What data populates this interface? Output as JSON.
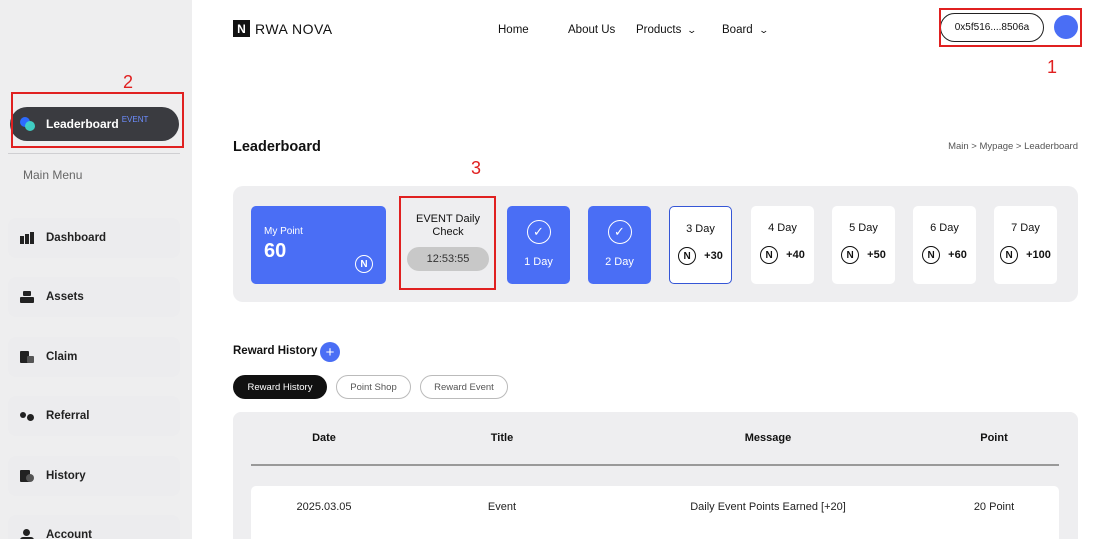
{
  "header": {
    "logo_mark": "N",
    "logo_text": "RWA NOVA",
    "nav": [
      {
        "label": "Home"
      },
      {
        "label": "About Us"
      },
      {
        "label": "Products",
        "icon": "chevron-down-icon"
      },
      {
        "label": "Board",
        "icon": "chevron-down-icon"
      }
    ],
    "wallet_address": "0x5f516....8506a",
    "avatar_color": "#4a6ef5"
  },
  "sidebar": {
    "active_item": {
      "label": "Leaderboard",
      "badge": "EVENT"
    },
    "section_label": "Main Menu",
    "items": [
      {
        "label": "Dashboard",
        "icon": "dashboard-icon"
      },
      {
        "label": "Assets",
        "icon": "assets-icon"
      },
      {
        "label": "Claim",
        "icon": "claim-icon"
      },
      {
        "label": "Referral",
        "icon": "referral-icon"
      },
      {
        "label": "History",
        "icon": "history-icon"
      },
      {
        "label": "Account",
        "icon": "account-icon"
      }
    ]
  },
  "page": {
    "title": "Leaderboard",
    "breadcrumb": "Main > Mypage > Leaderboard"
  },
  "checkin": {
    "my_point_label": "My Point",
    "my_point_value": "60",
    "coin_symbol": "N",
    "event_title": "EVENT Daily Check",
    "timer": "12:53:55",
    "completed_days": [
      {
        "label": "1 Day",
        "icon": "check-icon"
      },
      {
        "label": "2 Day",
        "icon": "check-icon"
      }
    ],
    "upcoming_days": [
      {
        "label": "3 Day",
        "reward": "+30",
        "current": true
      },
      {
        "label": "4 Day",
        "reward": "+40"
      },
      {
        "label": "5 Day",
        "reward": "+50"
      },
      {
        "label": "6 Day",
        "reward": "+60"
      },
      {
        "label": "7 Day",
        "reward": "+100"
      }
    ],
    "accent_color": "#4a6ef5"
  },
  "annotations": {
    "one": "1",
    "two": "2",
    "three": "3",
    "color": "#e02020"
  },
  "reward_history": {
    "title": "Reward History",
    "add_symbol": "+",
    "tabs": [
      {
        "label": "Reward History",
        "active": true
      },
      {
        "label": "Point Shop"
      },
      {
        "label": "Reward Event"
      }
    ],
    "columns": [
      "Date",
      "Title",
      "Message",
      "Point"
    ],
    "rows": [
      [
        "2025.03.05",
        "Event",
        "Daily Event Points Earned [+20]",
        "20 Point"
      ]
    ]
  }
}
